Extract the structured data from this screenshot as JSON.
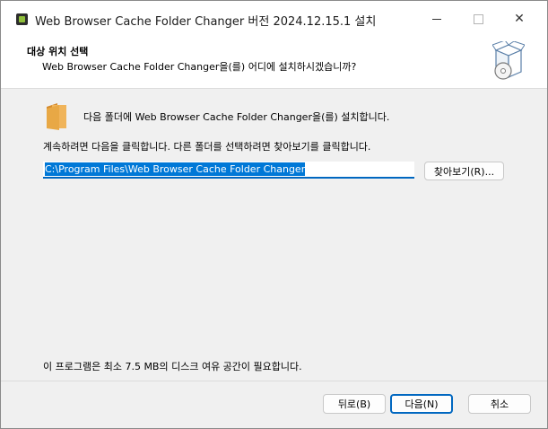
{
  "window": {
    "title": "Web Browser Cache Folder Changer 버전 2024.12.15.1 설치",
    "min_icon": "minimize-icon",
    "max_icon": "maximize-icon",
    "close_icon": "close-icon",
    "close_glyph": "✕"
  },
  "header": {
    "title": "대상 위치 선택",
    "subtitle": "Web Browser Cache Folder Changer을(를) 어디에 설치하시겠습니까?"
  },
  "main": {
    "install_text": "다음 폴더에 Web Browser Cache Folder Changer을(를) 설치합니다.",
    "instruction": "계속하려면 다음을 클릭합니다. 다른 폴더를 선택하려면 찾아보기를 클릭합니다.",
    "path_value": "C:\\Program Files\\Web Browser Cache Folder Changer",
    "browse_label": "찾아보기(R)...",
    "space_required": "이 프로그램은 최소 7.5 MB의 디스크 여유 공간이 필요합니다."
  },
  "footer": {
    "back_label": "뒤로(B)",
    "next_label": "다음(N)",
    "cancel_label": "취소"
  },
  "colors": {
    "accent": "#0067c0",
    "selection": "#0078d7",
    "folder": "#e8a845"
  }
}
